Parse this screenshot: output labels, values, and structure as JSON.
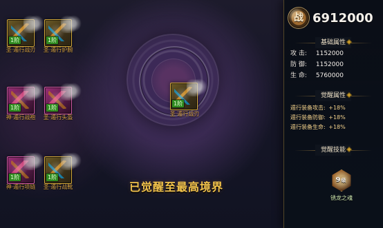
{
  "left_grid": {
    "slots": [
      {
        "rank": "1阶",
        "name": "圣·遁行战刃",
        "style": "gold"
      },
      {
        "rank": "1阶",
        "name": "圣·遁行护腕",
        "style": "gold"
      },
      {
        "rank": "1阶",
        "name": "神·遁行战袍",
        "style": "purple"
      },
      {
        "rank": "1阶",
        "name": "圣·遁行头盔",
        "style": "purple"
      },
      {
        "rank": "1阶",
        "name": "神·遁行项链",
        "style": "purple"
      },
      {
        "rank": "1阶",
        "name": "圣·遁行战靴",
        "style": "gold"
      }
    ]
  },
  "center": {
    "rank": "1阶",
    "name": "圣·遁行战刃",
    "message": "已觉醒至最高境界"
  },
  "right_panel": {
    "power": {
      "emblem": "战",
      "value": "6912000"
    },
    "basic_title": "基础属性",
    "basic_stats": [
      {
        "key": "攻 击:",
        "value": "1152000"
      },
      {
        "key": "防 御:",
        "value": "1152000"
      },
      {
        "key": "生 命:",
        "value": "5760000"
      }
    ],
    "awaken_title": "觉醒属性",
    "awaken_stats": [
      {
        "key": "遁行装备攻击:",
        "value": "+18%"
      },
      {
        "key": "遁行装备防御:",
        "value": "+18%"
      },
      {
        "key": "遁行装备生命:",
        "value": "+18%"
      }
    ],
    "skill_title": "觉醒技能",
    "skill": {
      "level_num": "9",
      "level_unit": "级",
      "name": "锈龙之魂"
    }
  }
}
